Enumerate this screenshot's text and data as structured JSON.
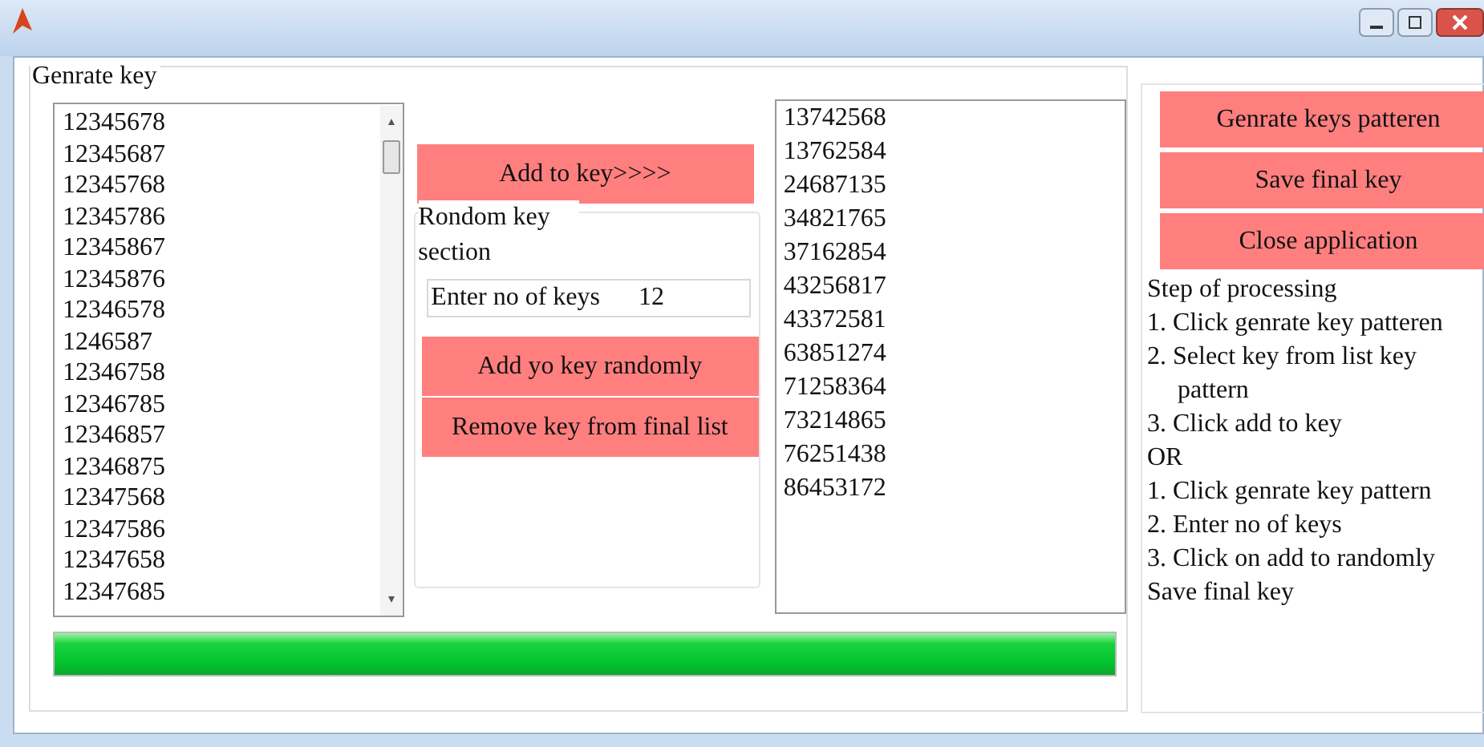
{
  "group_title": "Genrate key",
  "key_pattern_list": {
    "items": [
      "12345678",
      "12345687",
      "12345768",
      "12345786",
      "12345867",
      "12345876",
      "12346578",
      "1246587",
      "12346758",
      "12346785",
      "12346857",
      "12346875",
      "12347568",
      "12347586",
      "12347658",
      "12347685"
    ]
  },
  "add_button": "Add to key>>>>",
  "random_section": {
    "title": "Rondom key section",
    "count_field": {
      "label": "Enter no of keys",
      "value": "12"
    },
    "buttons": [
      "Add yo key randomly",
      "Remove key from final list"
    ]
  },
  "final_key_list": {
    "items": [
      "13742568",
      "13762584",
      "24687135",
      "34821765",
      "37162854",
      "43256817",
      "43372581",
      "63851274",
      "71258364",
      "73214865",
      "76251438",
      "86453172"
    ]
  },
  "progress": {
    "level": 1
  },
  "actions": [
    "Genrate keys patteren",
    "Save final key",
    "Close application"
  ],
  "instructions": [
    "Step of processing",
    "1. Click genrate key patteren",
    "2. Select key from list key pattern",
    "3. Click add to key",
    "OR",
    "1. Click genrate key pattern",
    "2. Enter no of keys",
    "3. Click on add to randomly",
    "Save final key"
  ]
}
